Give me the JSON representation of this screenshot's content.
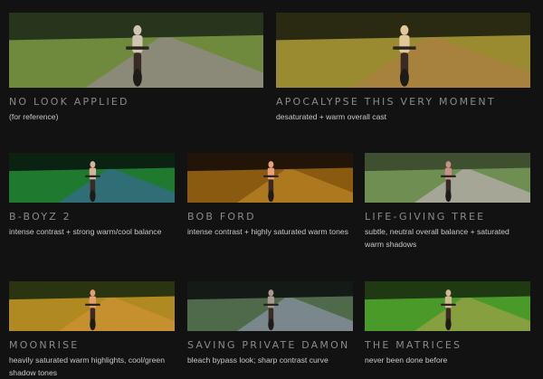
{
  "looks": [
    {
      "title": "NO LOOK APPLIED",
      "description": "(for reference)",
      "palette": {
        "sky": "#3b4a2a",
        "trees": "#27351c",
        "grass": "#6f8a3c",
        "road": "#8c8a7c",
        "rider": "#cfc5b0"
      }
    },
    {
      "title": "APOCALYPSE THIS VERY MOMENT",
      "description": "desaturated + warm overall cast",
      "palette": {
        "sky": "#3a3418",
        "trees": "#2a2a12",
        "grass": "#9a8a30",
        "road": "#a8823e",
        "rider": "#e0c89a"
      }
    },
    {
      "title": "B-BOYZ 2",
      "description": "intense contrast + strong warm/cool balance",
      "palette": {
        "sky": "#0d1a10",
        "trees": "#0b2212",
        "grass": "#1f7a30",
        "road": "#2f6e78",
        "rider": "#d6b49a"
      }
    },
    {
      "title": "BOB FORD",
      "description": "intense contrast + highly saturated warm tones",
      "palette": {
        "sky": "#1c1208",
        "trees": "#221508",
        "grass": "#8a5a10",
        "road": "#b07a20",
        "rider": "#e8a07a"
      }
    },
    {
      "title": "LIFE-GIVING TREE",
      "description": "subtle, neutral overall balance + saturated warm shadows",
      "palette": {
        "sky": "#5a6a4a",
        "trees": "#3e5030",
        "grass": "#6e8e52",
        "road": "#a8a89a",
        "rider": "#c89088"
      }
    },
    {
      "title": "MOONRISE",
      "description": "heavily saturated warm highlights, cool/green shadow tones",
      "palette": {
        "sky": "#2a3a10",
        "trees": "#2a3410",
        "grass": "#b08a20",
        "road": "#c89030",
        "rider": "#e0a070"
      }
    },
    {
      "title": "SAVING PRIVATE DAMON",
      "description": "bleach bypass look; sharp contrast curve",
      "palette": {
        "sky": "#0e1210",
        "trees": "#141a16",
        "grass": "#4e6a4a",
        "road": "#7c8a90",
        "rider": "#a89890"
      }
    },
    {
      "title": "THE MATRICES",
      "description": "never been done before",
      "palette": {
        "sky": "#1a2a10",
        "trees": "#1f3a12",
        "grass": "#4a9a2a",
        "road": "#8aa040",
        "rider": "#d0b890"
      }
    }
  ]
}
